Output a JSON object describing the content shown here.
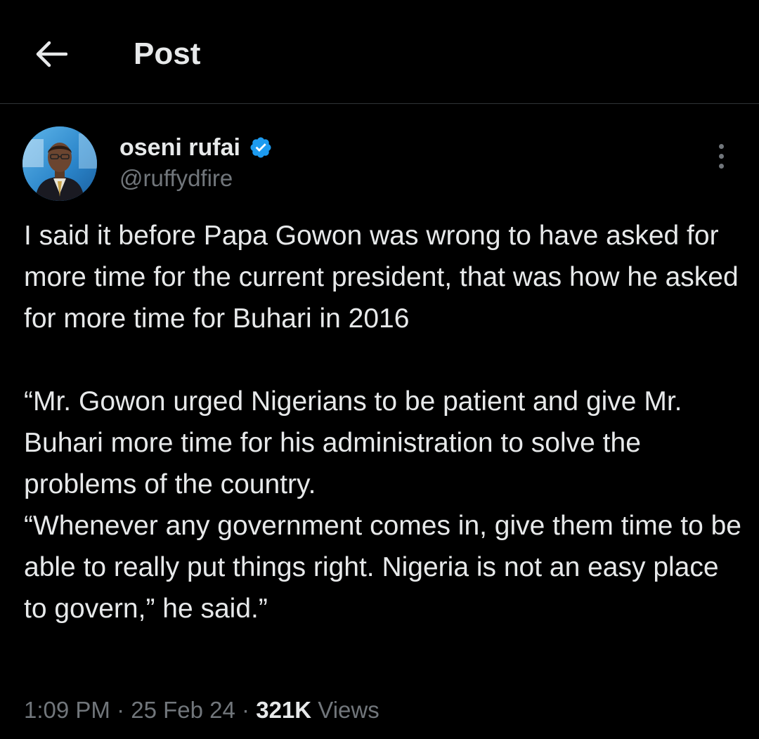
{
  "header": {
    "title": "Post",
    "back_icon": "arrow-left-icon"
  },
  "author": {
    "display_name": "oseni rufai",
    "handle": "@ruffydfire",
    "verified_icon": "verified-badge-icon",
    "verified_color": "#1d9bf0"
  },
  "tweet": {
    "paragraph1": "I said it before Papa Gowon was wrong to have asked for more time for the current president, that was how he asked for more time for Buhari in 2016",
    "paragraph2": "“Mr. Gowon urged Nigerians to be patient and give Mr. Buhari more time for his administration to solve the problems of the country.",
    "paragraph3": "“Whenever any government comes in, give them time to be able to really put things right. Nigeria is not an easy place to govern,” he said.”"
  },
  "meta": {
    "time": "1:09 PM",
    "separator": "·",
    "date": "25 Feb 24",
    "views_count": "321K",
    "views_label": "Views"
  },
  "colors": {
    "background": "#000000",
    "text_primary": "#e7e9ea",
    "text_secondary": "#71767b",
    "divider": "#2f3336"
  }
}
